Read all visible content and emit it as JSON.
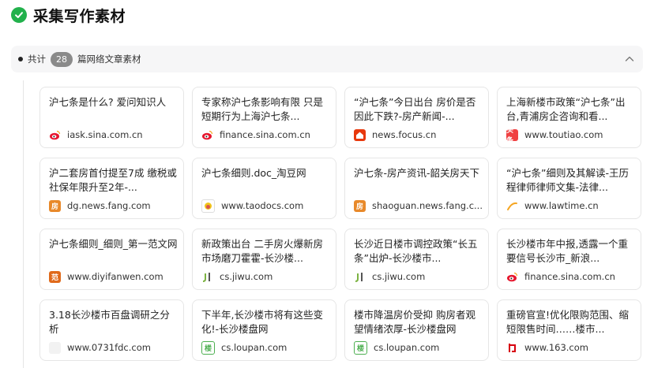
{
  "header": {
    "title": "采集写作素材"
  },
  "summary": {
    "prefix": "共计",
    "count": "28",
    "suffix": "篇网络文章素材"
  },
  "cards": [
    {
      "title": "沪七条是什么? 爱问知识人",
      "domain": "iask.sina.com.cn",
      "icon": "sina-weibo-icon",
      "color": "#e6162d"
    },
    {
      "title": "专家称沪七条影响有限 只是短期行为上海沪七条...",
      "domain": "finance.sina.com.cn",
      "icon": "sina-weibo-icon",
      "color": "#e6162d"
    },
    {
      "title": "“沪七条”今日出台 房价是否因此下跌?-房产新闻-...",
      "domain": "news.focus.cn",
      "icon": "focus-icon",
      "color": "#e8380d"
    },
    {
      "title": "上海新楼市政策“沪七条”出台,青浦房企咨询和看...",
      "domain": "www.toutiao.com",
      "icon": "toutiao-icon",
      "color": "#f04142",
      "text": "头条"
    },
    {
      "title": "沪二套房首付提至7成 缴税或社保年限升至2年-...",
      "domain": "dg.news.fang.com",
      "icon": "fang-icon",
      "color": "#e8892a",
      "text": "房"
    },
    {
      "title": "沪七条细则.doc_淘豆网",
      "domain": "www.taodocs.com",
      "icon": "taodocs-icon",
      "color": "#d9534f"
    },
    {
      "title": "沪七条-房产资讯-韶关房天下",
      "domain": "shaoguan.news.fang.c...",
      "icon": "fang-icon",
      "color": "#e8892a",
      "text": "房"
    },
    {
      "title": "“沪七条”细则及其解读-王历程律师律师文集-法律...",
      "domain": "www.lawtime.cn",
      "icon": "lawtime-icon",
      "color": "#f5a623"
    },
    {
      "title": "沪七条细则_细则_第一范文网",
      "domain": "www.diyifanwen.com",
      "icon": "diyifanwen-icon",
      "color": "#e06a1b",
      "text": "范"
    },
    {
      "title": "新政策出台 二手房火爆新房市场磨刀霍霍-长沙楼...",
      "domain": "cs.jiwu.com",
      "icon": "jiwu-icon",
      "color": "#7cb342"
    },
    {
      "title": "长沙近日楼市调控政策“长五条”出炉-长沙楼市...",
      "domain": "cs.jiwu.com",
      "icon": "jiwu-icon",
      "color": "#7cb342"
    },
    {
      "title": "长沙楼市年中报,透露一个重要信号长沙市_新浪...",
      "domain": "finance.sina.com.cn",
      "icon": "sina-weibo-icon",
      "color": "#e6162d"
    },
    {
      "title": "3.18长沙楼市百盘调研之分析",
      "domain": "www.0731fdc.com",
      "icon": "blank-icon",
      "color": "#f2f2f2"
    },
    {
      "title": "下半年,长沙楼市将有这些变化!-长沙楼盘网",
      "domain": "cs.loupan.com",
      "icon": "loupan-icon",
      "color": "#4caf50",
      "text": "楼"
    },
    {
      "title": "楼市降温房价受抑 购房者观望情绪浓厚-长沙楼盘网",
      "domain": "cs.loupan.com",
      "icon": "loupan-icon",
      "color": "#4caf50",
      "text": "楼"
    },
    {
      "title": "重磅官宣!优化限购范围、缩短限售时间……楼市...",
      "domain": "www.163.com",
      "icon": "netease-icon",
      "color": "#d7000f"
    }
  ]
}
